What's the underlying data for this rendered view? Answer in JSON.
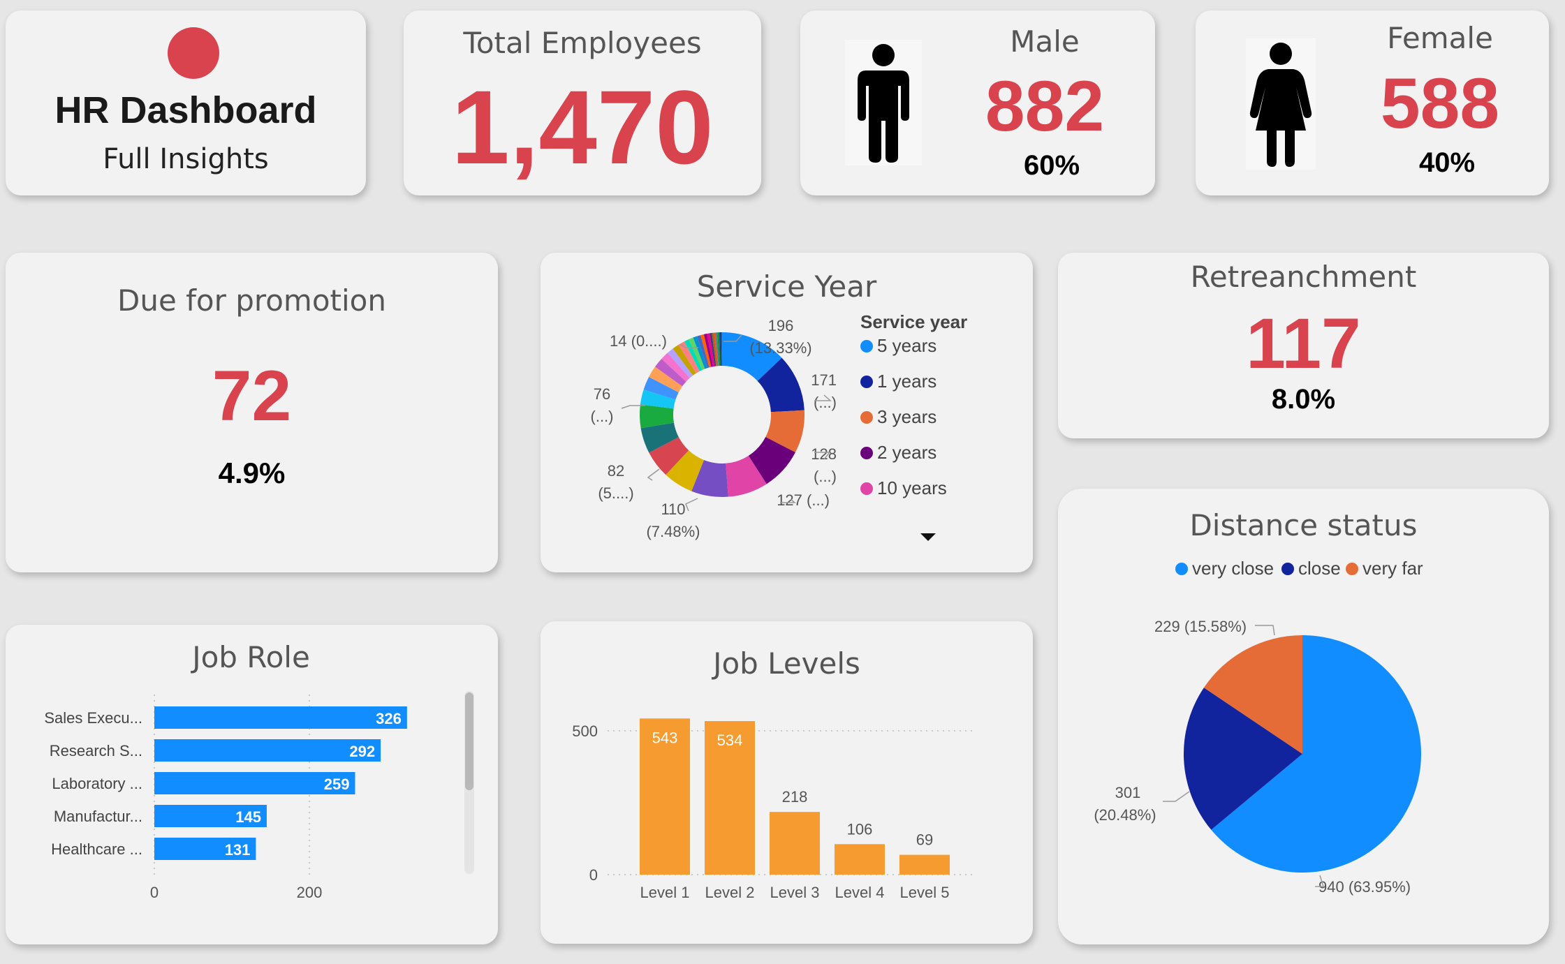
{
  "title_card": {
    "title": "HR Dashboard",
    "subtitle": "Full Insights",
    "dot_color": "#d8434e"
  },
  "total_employees": {
    "label": "Total Employees",
    "value": "1,470"
  },
  "male": {
    "label": "Male",
    "value": "882",
    "pct": "60%",
    "icon": "male-person-icon"
  },
  "female": {
    "label": "Female",
    "value": "588",
    "pct": "40%",
    "icon": "female-person-icon"
  },
  "promotion": {
    "label": "Due for promotion",
    "value": "72",
    "pct": "4.9%"
  },
  "retrenchment": {
    "label": "Retreanchment",
    "value": "117",
    "pct": "8.0%"
  },
  "colors": {
    "accent_red": "#d8434e",
    "blue": "#118dff",
    "navy": "#12239e",
    "orange": "#e66c37",
    "bar_orange": "#f59b2f"
  },
  "chart_data": [
    {
      "id": "service_year",
      "type": "donut",
      "title": "Service Year",
      "legend_title": "Service year",
      "legend": [
        {
          "name": "5 years",
          "color": "#118dff"
        },
        {
          "name": "1 years",
          "color": "#12239e"
        },
        {
          "name": "3 years",
          "color": "#e66c37"
        },
        {
          "name": "2 years",
          "color": "#6b007b"
        },
        {
          "name": "10 years",
          "color": "#e044a7"
        }
      ],
      "slices": [
        {
          "value": 196,
          "color": "#118dff"
        },
        {
          "value": 171,
          "color": "#12239e"
        },
        {
          "value": 128,
          "color": "#e66c37"
        },
        {
          "value": 127,
          "color": "#6b007b"
        },
        {
          "value": 120,
          "color": "#e044a7"
        },
        {
          "value": 110,
          "color": "#744ec2"
        },
        {
          "value": 90,
          "color": "#d9b300"
        },
        {
          "value": 82,
          "color": "#d64550"
        },
        {
          "value": 76,
          "color": "#197278"
        },
        {
          "value": 70,
          "color": "#1aab40"
        },
        {
          "value": 45,
          "color": "#15c6f4"
        },
        {
          "value": 40,
          "color": "#4092ff"
        },
        {
          "value": 35,
          "color": "#ffa058"
        },
        {
          "value": 30,
          "color": "#be5dc9"
        },
        {
          "value": 25,
          "color": "#f472d0"
        },
        {
          "value": 20,
          "color": "#b5a1ff"
        },
        {
          "value": 20,
          "color": "#c4a200"
        },
        {
          "value": 20,
          "color": "#ff8080"
        },
        {
          "value": 14,
          "color": "#00dbbc"
        },
        {
          "value": 14,
          "color": "#5bd667"
        },
        {
          "value": 12,
          "color": "#0091d5"
        },
        {
          "value": 11,
          "color": "#4668c5"
        },
        {
          "value": 10,
          "color": "#ff6300"
        },
        {
          "value": 9,
          "color": "#99008a"
        },
        {
          "value": 8,
          "color": "#ec008c"
        },
        {
          "value": 7,
          "color": "#533285"
        },
        {
          "value": 6,
          "color": "#99700a"
        },
        {
          "value": 5,
          "color": "#ff4141"
        },
        {
          "value": 5,
          "color": "#1f9a85"
        },
        {
          "value": 5,
          "color": "#25891c"
        },
        {
          "value": 4,
          "color": "#0057a2"
        },
        {
          "value": 3,
          "color": "#002050"
        },
        {
          "value": 2,
          "color": "#c94f0f"
        }
      ],
      "labels": [
        {
          "line1": "196",
          "line2": "(13.33%)"
        },
        {
          "line1": "171",
          "line2": "(...)"
        },
        {
          "line1": "128",
          "line2": "(...)"
        },
        {
          "line1": "127 (...)",
          "line2": ""
        },
        {
          "line1": "110",
          "line2": "(7.48%)"
        },
        {
          "line1": "82",
          "line2": "(5....)"
        },
        {
          "line1": "76",
          "line2": "(...)"
        },
        {
          "line1": "14 (0....)",
          "line2": ""
        }
      ]
    },
    {
      "id": "job_role",
      "type": "bar",
      "orientation": "horizontal",
      "title": "Job Role",
      "categories": [
        "Sales Execu...",
        "Research S...",
        "Laboratory ...",
        "Manufactur...",
        "Healthcare ..."
      ],
      "values": [
        326,
        292,
        259,
        145,
        131
      ],
      "xlim": [
        0,
        400
      ],
      "xticks": [
        "0",
        "200"
      ],
      "color": "#118dff"
    },
    {
      "id": "job_levels",
      "type": "bar",
      "title": "Job Levels",
      "categories": [
        "Level 1",
        "Level 2",
        "Level 3",
        "Level 4",
        "Level 5"
      ],
      "values": [
        543,
        534,
        218,
        106,
        69
      ],
      "ylim": [
        0,
        543
      ],
      "yticks": [
        "0",
        "500"
      ],
      "color": "#f59b2f"
    },
    {
      "id": "distance_status",
      "type": "pie",
      "title": "Distance status",
      "legend": [
        {
          "name": "very close",
          "color": "#118dff"
        },
        {
          "name": "close",
          "color": "#12239e"
        },
        {
          "name": "very far",
          "color": "#e66c37"
        }
      ],
      "slices": [
        {
          "name": "very close",
          "value": 940,
          "label": "940 (63.95%)",
          "color": "#118dff"
        },
        {
          "name": "close",
          "value": 301,
          "label": "301",
          "label2": "(20.48%)",
          "color": "#12239e"
        },
        {
          "name": "very far",
          "value": 229,
          "label": "229 (15.58%)",
          "color": "#e66c37"
        }
      ]
    }
  ]
}
